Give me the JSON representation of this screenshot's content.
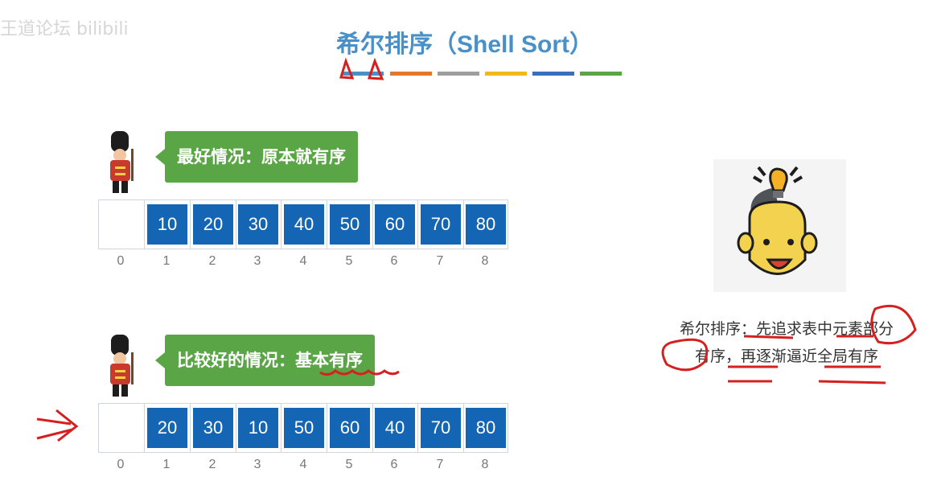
{
  "watermark": "王道论坛 bilibili",
  "title": "希尔排序（Shell Sort）",
  "color_bar": [
    "#4a90c8",
    "#e8772e",
    "#9e9e9e",
    "#f2b91e",
    "#3a6fc0",
    "#5aa646"
  ],
  "case_best": {
    "label": "最好情况：原本就有序",
    "values": [
      "",
      "10",
      "20",
      "30",
      "40",
      "50",
      "60",
      "70",
      "80"
    ],
    "indices": [
      "0",
      "1",
      "2",
      "3",
      "4",
      "5",
      "6",
      "7",
      "8"
    ]
  },
  "case_good": {
    "label": "比较好的情况：基本有序",
    "values": [
      "",
      "20",
      "30",
      "10",
      "50",
      "60",
      "40",
      "70",
      "80"
    ],
    "indices": [
      "0",
      "1",
      "2",
      "3",
      "4",
      "5",
      "6",
      "7",
      "8"
    ]
  },
  "side_note": {
    "line1": "希尔排序：先追求表中元素部分",
    "line2": "有序，再逐渐逼近全局有序"
  },
  "icons": [
    "guard-icon",
    "idea-head-icon"
  ],
  "colors": {
    "title": "#4a90c8",
    "callout": "#5aa646",
    "cell": "#1565b5",
    "annotation": "#d62020"
  }
}
